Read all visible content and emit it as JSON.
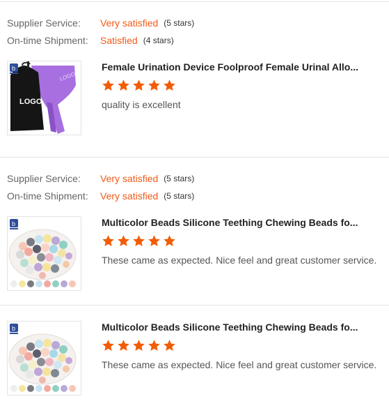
{
  "reviews": [
    {
      "ratings": [
        {
          "label": "Supplier Service:",
          "value": "Very satisfied",
          "count": "(5 stars)"
        },
        {
          "label": "On-time Shipment:",
          "value": "Satisfied",
          "count": "(4 stars)"
        }
      ],
      "product": {
        "title": "Female Urination Device Foolproof Female Urinal Allo...",
        "image_logo_text": "LOGO",
        "image": "bag-and-funnel",
        "stars": 5,
        "comment": "quality is excellent"
      }
    },
    {
      "ratings": [
        {
          "label": "Supplier Service:",
          "value": "Very satisfied",
          "count": "(5 stars)"
        },
        {
          "label": "On-time Shipment:",
          "value": "Very satisfied",
          "count": "(5 stars)"
        }
      ],
      "product": {
        "title": "Multicolor Beads Silicone Teething Chewing Beads fo...",
        "image": "beads-bowl",
        "stars": 5,
        "comment": "These came as expected. Nice feel and great customer service."
      }
    },
    {
      "ratings": [],
      "product": {
        "title": "Multicolor Beads Silicone Teething Chewing Beads fo...",
        "image": "beads-bowl",
        "stars": 5,
        "comment": "These came as expected. Nice feel and great customer service."
      }
    }
  ],
  "colors": {
    "accent": "#f05a1a",
    "star": "#f25c05",
    "divider": "#e4e4e4"
  }
}
